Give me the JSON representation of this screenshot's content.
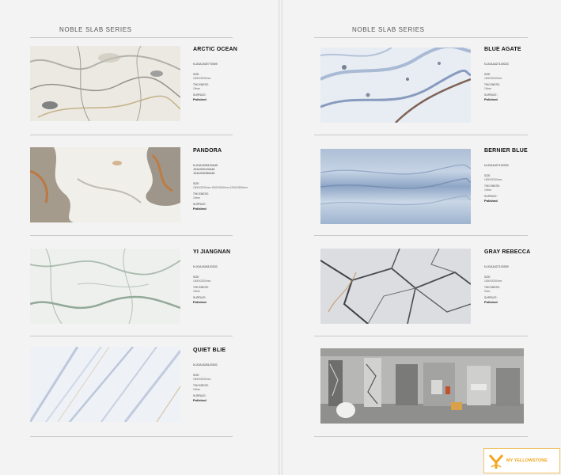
{
  "series_title": "NOBLE SLAB SERIES",
  "left_products": [
    {
      "name": "ARCTIC OCEAN",
      "code": "N.JOA1920??2009",
      "size_label": "SIZE:",
      "size_value": "1600X3200mm",
      "thickness_label": "THICKNESS:",
      "thickness_value": "15mm",
      "surface_label": "SURFACE:",
      "surface_value": "Polished"
    },
    {
      "name": "PANDORA",
      "code": "N.JGA1626120A45\nJGA1920120A45\nJGA1930280A45",
      "size_label": "SIZE:",
      "size_value": "1600X3200mm 1900X3000mm 1200X2800mm",
      "thickness_label": "THICKNESS:",
      "thickness_value": "15mm",
      "surface_label": "SURFACE:",
      "surface_value": "Polished"
    },
    {
      "name": "YI JIANGNAN",
      "code": "N.JGA1626120332",
      "size_label": "SIZE:",
      "size_value": "1600X3200mm",
      "thickness_label": "THICKNESS:",
      "thickness_value": "15mm",
      "surface_label": "SURFACE:",
      "surface_value": "Polished"
    },
    {
      "name": "QUIET BLIE",
      "code": "N.JGA1626120302",
      "size_label": "SIZE:",
      "size_value": "1600X3200mm",
      "thickness_label": "THICKNESS:",
      "thickness_value": "15mm",
      "surface_label": "SURFACE:",
      "surface_value": "Polished"
    }
  ],
  "right_products": [
    {
      "name": "BLUE AGATE",
      "code": "N.JGA1627120023",
      "size_label": "SIZE:",
      "size_value": "1600X3200mm",
      "thickness_label": "THICKNESS:",
      "thickness_value": "15mm",
      "surface_label": "SURFACE:",
      "surface_value": "Polished"
    },
    {
      "name": "BERNIER BLUE",
      "code": "N.JGA1627120230",
      "size_label": "SIZE:",
      "size_value": "1600X3200mm",
      "thickness_label": "THICKNESS:",
      "thickness_value": "15mm",
      "surface_label": "SURFACE:",
      "surface_value": "Polished"
    },
    {
      "name": "GRAY REBECCA",
      "code": "N.JGA1627120309",
      "size_label": "SIZE:",
      "size_value": "1600X3200mm",
      "thickness_label": "THICKNESS:",
      "thickness_value": "9mm",
      "surface_label": "SURFACE:",
      "surface_value": "Polished"
    }
  ],
  "logo": {
    "text": "MY YELLOWSTONE",
    "color": "#f2a51d"
  }
}
